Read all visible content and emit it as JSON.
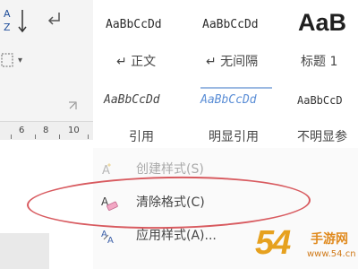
{
  "ribbon": {
    "ruler_numbers": [
      "6",
      "8",
      "10"
    ]
  },
  "styles_gallery": {
    "row1": [
      {
        "preview": "AaBbCcDd",
        "name": "↵ 正文"
      },
      {
        "preview": "AaBbCcDd",
        "name": "↵ 无间隔"
      },
      {
        "preview": "AaB",
        "name": "标题 1"
      }
    ],
    "row2": [
      {
        "preview": "AaBbCcDd",
        "name": "引用"
      },
      {
        "preview": "AaBbCcDd",
        "name": "明显引用"
      },
      {
        "preview": "AaBbCcD",
        "name": "不明显参"
      }
    ]
  },
  "menu": {
    "items": [
      {
        "label": "创建样式(S)",
        "disabled": true
      },
      {
        "label": "清除格式(C)",
        "disabled": false
      },
      {
        "label": "应用样式(A)...",
        "disabled": false
      }
    ]
  },
  "annotation": {
    "color": "#d85a5f"
  },
  "watermark": {
    "number": "54",
    "text": "手游网",
    "url": "www.54.cn"
  },
  "colors": {
    "accent_blue": "#5b8ed6",
    "watermark_orange": "#e6a11f"
  }
}
